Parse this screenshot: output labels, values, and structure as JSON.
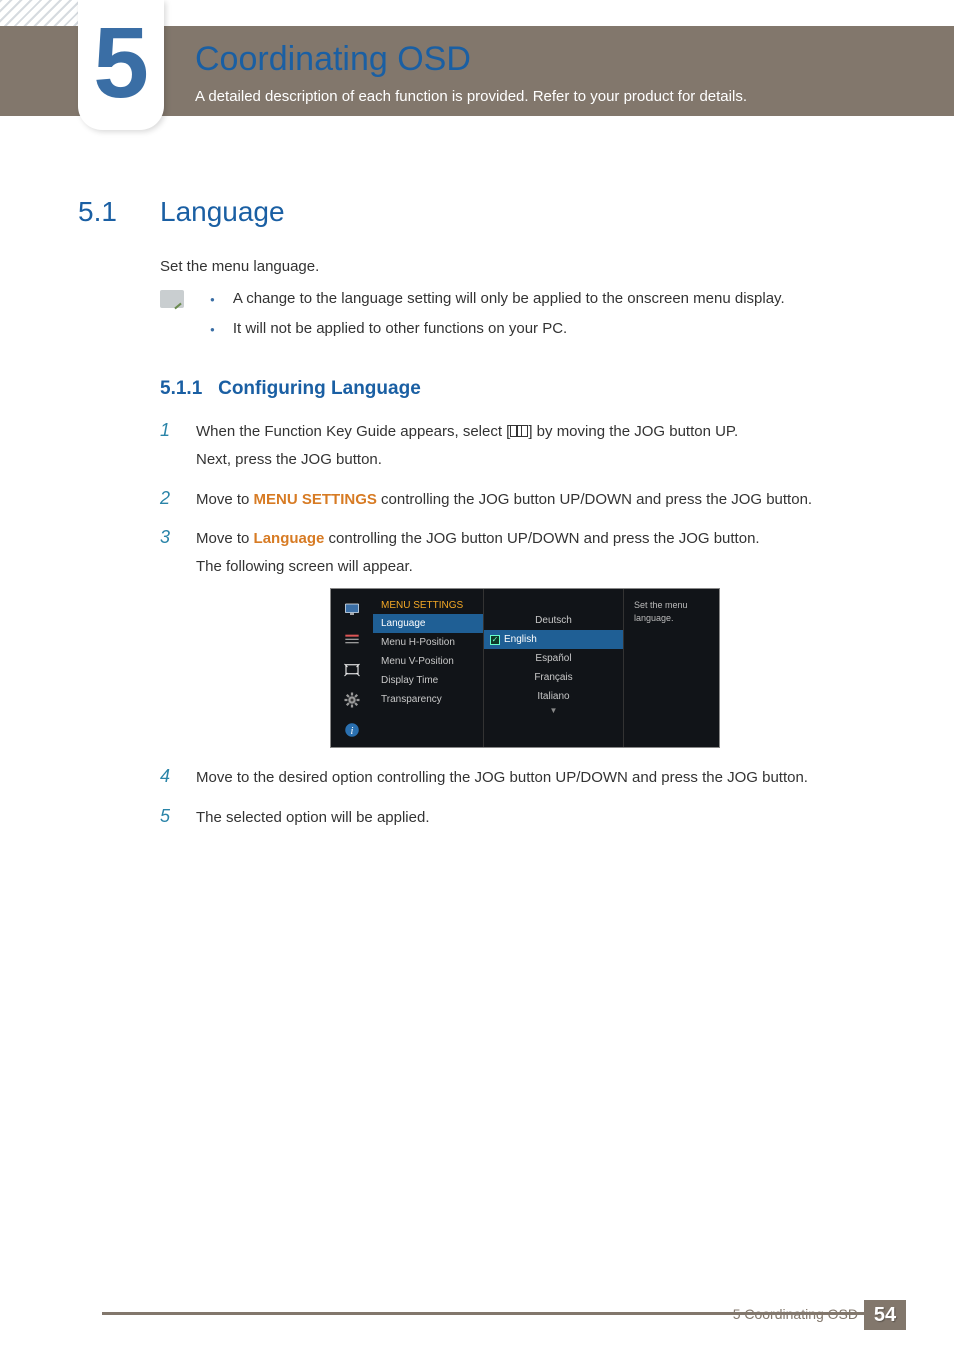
{
  "chapter": {
    "num": "5",
    "title": "Coordinating OSD",
    "subtitle": "A detailed description of each function is provided. Refer to your product for details."
  },
  "section": {
    "num": "5.1",
    "title": "Language",
    "intro": "Set the menu language."
  },
  "notes": [
    "A change to the language setting will only be applied to the onscreen menu display.",
    "It will not be applied to other functions on your PC."
  ],
  "subsection": {
    "num": "5.1.1",
    "title": "Configuring Language"
  },
  "steps_a": [
    {
      "n": "1",
      "pre": "When the Function Key Guide appears, select [",
      "post": "] by moving the JOG button UP.",
      "cont": "Next, press the JOG button."
    },
    {
      "n": "2",
      "pre": "Move to ",
      "kw": "MENU SETTINGS",
      "post": " controlling the JOG button UP/DOWN and press the JOG button."
    },
    {
      "n": "3",
      "pre": "Move to ",
      "kw": "Language",
      "post": " controlling the JOG button UP/DOWN and press the JOG button.",
      "cont": "The following screen will appear."
    }
  ],
  "steps_b": [
    {
      "n": "4",
      "text": "Move to the desired option controlling the JOG button UP/DOWN and press the JOG button."
    },
    {
      "n": "5",
      "text": "The selected option will be applied."
    }
  ],
  "osd": {
    "header": "MENU SETTINGS",
    "items": [
      "Language",
      "Menu H-Position",
      "Menu V-Position",
      "Display Time",
      "Transparency"
    ],
    "selected_item_idx": 0,
    "options": [
      "Deutsch",
      "English",
      "Español",
      "Français",
      "Italiano"
    ],
    "selected_option_idx": 1,
    "desc": "Set the menu language."
  },
  "footer": {
    "label": "5 Coordinating OSD",
    "page": "54"
  }
}
